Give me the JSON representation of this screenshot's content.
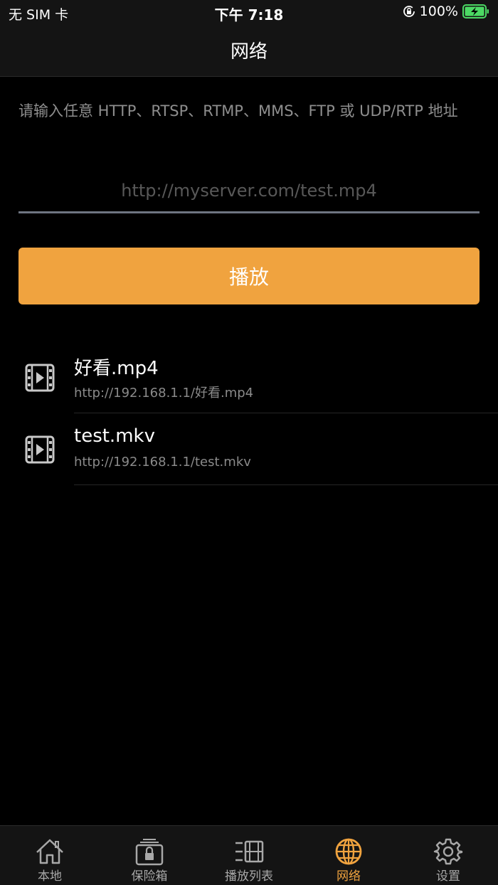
{
  "status_bar": {
    "carrier": "无 SIM 卡",
    "time": "下午 7:18",
    "battery_percent": "100%"
  },
  "nav": {
    "title": "网络"
  },
  "form": {
    "prompt": "请输入任意 HTTP、RTSP、RTMP、MMS、FTP 或 UDP/RTP 地址",
    "url_placeholder": "http://myserver.com/test.mp4",
    "url_value": "",
    "play_label": "播放"
  },
  "history": [
    {
      "title": "好看.mp4",
      "url": "http://192.168.1.1/好看.mp4",
      "icon": "video-file-icon"
    },
    {
      "title": "test.mkv",
      "url": "http://192.168.1.1/test.mkv",
      "icon": "video-file-icon"
    }
  ],
  "tabs": [
    {
      "label": "本地",
      "icon": "home-icon",
      "active": false
    },
    {
      "label": "保险箱",
      "icon": "safe-lock-icon",
      "active": false
    },
    {
      "label": "播放列表",
      "icon": "playlist-icon",
      "active": false
    },
    {
      "label": "网络",
      "icon": "globe-icon",
      "active": true
    },
    {
      "label": "设置",
      "icon": "gear-icon",
      "active": false
    }
  ],
  "colors": {
    "accent": "#f0a33f",
    "background": "#000000",
    "bar_background": "#141414",
    "inactive_tab": "#a8a8a8",
    "battery_fill": "#4cd964"
  }
}
